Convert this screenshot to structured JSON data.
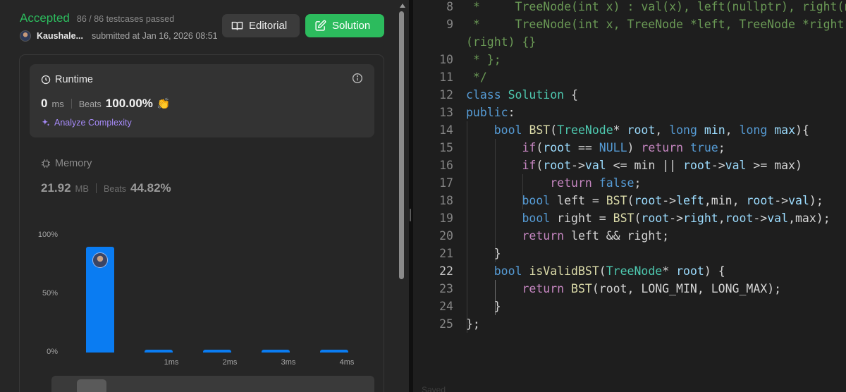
{
  "result": {
    "status": "Accepted",
    "testcases": "86 / 86 testcases passed",
    "username": "Kaushale...",
    "submitted": "submitted at Jan 16, 2026 08:51"
  },
  "buttons": {
    "editorial": "Editorial",
    "solution": "Solution"
  },
  "runtime": {
    "title": "Runtime",
    "value": "0",
    "unit": "ms",
    "beats_label": "Beats",
    "beats": "100.00%",
    "analyze": "Analyze Complexity"
  },
  "memory": {
    "title": "Memory",
    "value": "21.92",
    "unit": "MB",
    "beats_label": "Beats",
    "beats": "44.82%"
  },
  "chart_data": {
    "type": "bar",
    "categories": [
      "",
      "1ms",
      "2ms",
      "3ms",
      "4ms"
    ],
    "values": [
      90.5,
      2.5,
      2.5,
      2.5,
      2.5
    ],
    "y_ticks": [
      "100%",
      "50%",
      "0%"
    ],
    "ylim": [
      0,
      100
    ],
    "bar_color": "#0a7cf2",
    "highlighted_index": 0
  },
  "editor": {
    "lines": [
      {
        "n": "8",
        "segs": [
          [
            "cm",
            " *     TreeNode(int x) : val(x), left(nullptr), right(nullptr) {}"
          ]
        ]
      },
      {
        "n": "9",
        "segs": [
          [
            "cm",
            " *     TreeNode(int x, TreeNode *left, TreeNode *right) : val(x), left(left), right"
          ]
        ]
      },
      {
        "n": "",
        "segs": [
          [
            "cm",
            "(right) {}"
          ]
        ]
      },
      {
        "n": "10",
        "segs": [
          [
            "cm",
            " * };"
          ]
        ]
      },
      {
        "n": "11",
        "segs": [
          [
            "cm",
            " */"
          ]
        ]
      },
      {
        "n": "12",
        "segs": [
          [
            "kw",
            "class"
          ],
          [
            "pl",
            " "
          ],
          [
            "ty",
            "Solution"
          ],
          [
            "pl",
            " {"
          ]
        ]
      },
      {
        "n": "13",
        "segs": [
          [
            "kw",
            "public"
          ],
          [
            "pl",
            ":"
          ]
        ]
      },
      {
        "n": "14",
        "segs": [
          [
            "pl",
            "    "
          ],
          [
            "kw",
            "bool"
          ],
          [
            "pl",
            " "
          ],
          [
            "fn",
            "BST"
          ],
          [
            "pl",
            "("
          ],
          [
            "ty",
            "TreeNode"
          ],
          [
            "pl",
            "* "
          ],
          [
            "va",
            "root"
          ],
          [
            "pl",
            ", "
          ],
          [
            "kw",
            "long"
          ],
          [
            "pl",
            " "
          ],
          [
            "va",
            "min"
          ],
          [
            "pl",
            ", "
          ],
          [
            "kw",
            "long"
          ],
          [
            "pl",
            " "
          ],
          [
            "va",
            "max"
          ],
          [
            "pl",
            "){"
          ]
        ]
      },
      {
        "n": "15",
        "segs": [
          [
            "pl",
            "        "
          ],
          [
            "ctl",
            "if"
          ],
          [
            "pl",
            "("
          ],
          [
            "va",
            "root"
          ],
          [
            "pl",
            " == "
          ],
          [
            "kw",
            "NULL"
          ],
          [
            "pl",
            ") "
          ],
          [
            "ctl",
            "return"
          ],
          [
            "pl",
            " "
          ],
          [
            "kw",
            "true"
          ],
          [
            "pl",
            ";"
          ]
        ]
      },
      {
        "n": "16",
        "segs": [
          [
            "pl",
            "        "
          ],
          [
            "ctl",
            "if"
          ],
          [
            "pl",
            "("
          ],
          [
            "va",
            "root"
          ],
          [
            "pl",
            "->"
          ],
          [
            "va",
            "val"
          ],
          [
            "pl",
            " <= min || "
          ],
          [
            "va",
            "root"
          ],
          [
            "pl",
            "->"
          ],
          [
            "va",
            "val"
          ],
          [
            "pl",
            " >= max)"
          ]
        ]
      },
      {
        "n": "17",
        "segs": [
          [
            "pl",
            "            "
          ],
          [
            "ctl",
            "return"
          ],
          [
            "pl",
            " "
          ],
          [
            "kw",
            "false"
          ],
          [
            "pl",
            ";"
          ]
        ]
      },
      {
        "n": "18",
        "segs": [
          [
            "pl",
            "        "
          ],
          [
            "kw",
            "bool"
          ],
          [
            "pl",
            " left = "
          ],
          [
            "fn",
            "BST"
          ],
          [
            "pl",
            "("
          ],
          [
            "va",
            "root"
          ],
          [
            "pl",
            "->"
          ],
          [
            "va",
            "left"
          ],
          [
            "pl",
            ",min, "
          ],
          [
            "va",
            "root"
          ],
          [
            "pl",
            "->"
          ],
          [
            "va",
            "val"
          ],
          [
            "pl",
            ");"
          ]
        ]
      },
      {
        "n": "19",
        "segs": [
          [
            "pl",
            "        "
          ],
          [
            "kw",
            "bool"
          ],
          [
            "pl",
            " right = "
          ],
          [
            "fn",
            "BST"
          ],
          [
            "pl",
            "("
          ],
          [
            "va",
            "root"
          ],
          [
            "pl",
            "->"
          ],
          [
            "va",
            "right"
          ],
          [
            "pl",
            ","
          ],
          [
            "va",
            "root"
          ],
          [
            "pl",
            "->"
          ],
          [
            "va",
            "val"
          ],
          [
            "pl",
            ",max);"
          ]
        ]
      },
      {
        "n": "20",
        "segs": [
          [
            "pl",
            "        "
          ],
          [
            "ctl",
            "return"
          ],
          [
            "pl",
            " left && right;"
          ]
        ]
      },
      {
        "n": "21",
        "segs": [
          [
            "pl",
            "    }"
          ]
        ]
      },
      {
        "n": "22",
        "segs": [
          [
            "pl",
            "    "
          ],
          [
            "kw",
            "bool"
          ],
          [
            "pl",
            " "
          ],
          [
            "fn",
            "isValidBST"
          ],
          [
            "pl",
            "("
          ],
          [
            "ty",
            "TreeNode"
          ],
          [
            "pl",
            "* "
          ],
          [
            "va",
            "root"
          ],
          [
            "pl",
            ") {"
          ]
        ],
        "active": true
      },
      {
        "n": "23",
        "segs": [
          [
            "pl",
            "        "
          ],
          [
            "ctl",
            "return"
          ],
          [
            "pl",
            " "
          ],
          [
            "fn",
            "BST"
          ],
          [
            "pl",
            "(root, LONG_MIN, LONG_MAX);"
          ]
        ]
      },
      {
        "n": "24",
        "segs": [
          [
            "pl",
            "    }"
          ]
        ]
      },
      {
        "n": "25",
        "segs": [
          [
            "pl",
            "};"
          ]
        ]
      }
    ],
    "bottom_text": "Saved"
  }
}
